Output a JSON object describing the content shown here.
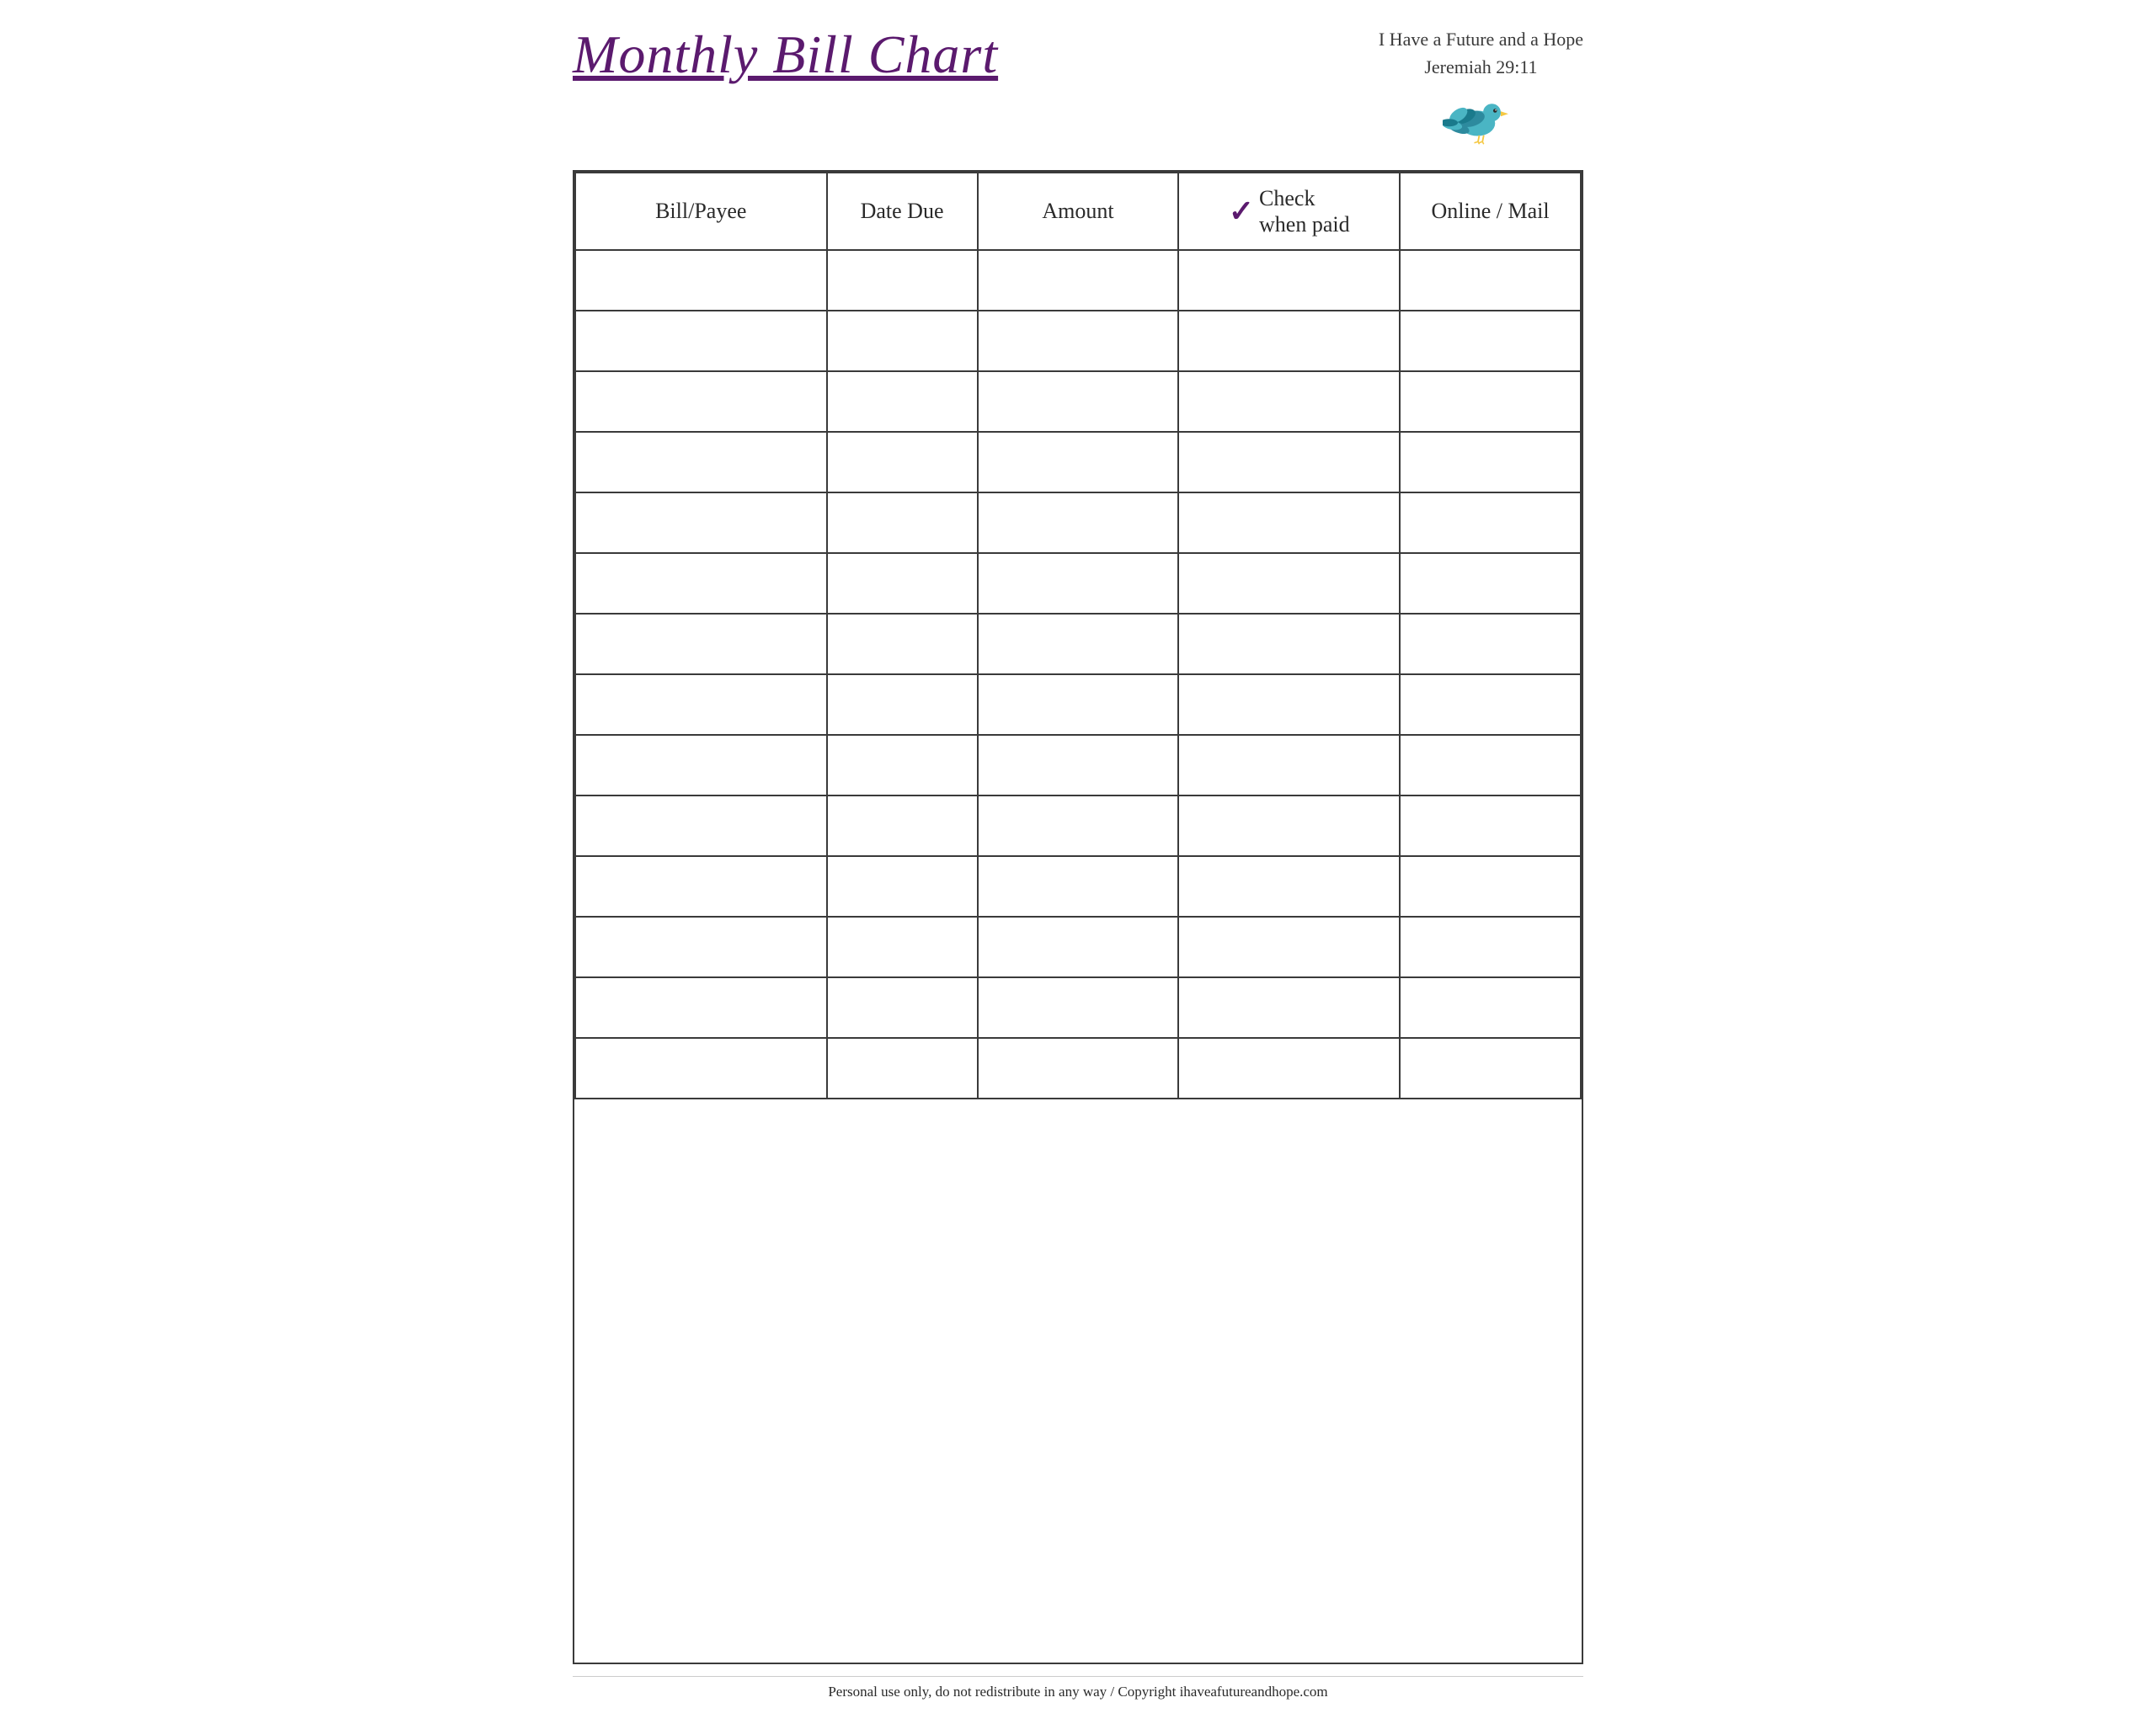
{
  "header": {
    "title": "Monthly Bill Chart",
    "subtitle_line1": "I Have a Future and a Hope",
    "subtitle_line2": "Jeremiah 29:11"
  },
  "table": {
    "columns": [
      {
        "id": "bill",
        "label": "Bill/Payee"
      },
      {
        "id": "date",
        "label": "Date Due"
      },
      {
        "id": "amount",
        "label": "Amount"
      },
      {
        "id": "check",
        "label_top": "Check",
        "label_bottom": "when paid"
      },
      {
        "id": "online",
        "label": "Online / Mail"
      }
    ],
    "row_count": 14
  },
  "footer": {
    "text": "Personal use only, do not redistribute in any way / Copyright ihaveafutureandhope.com"
  }
}
